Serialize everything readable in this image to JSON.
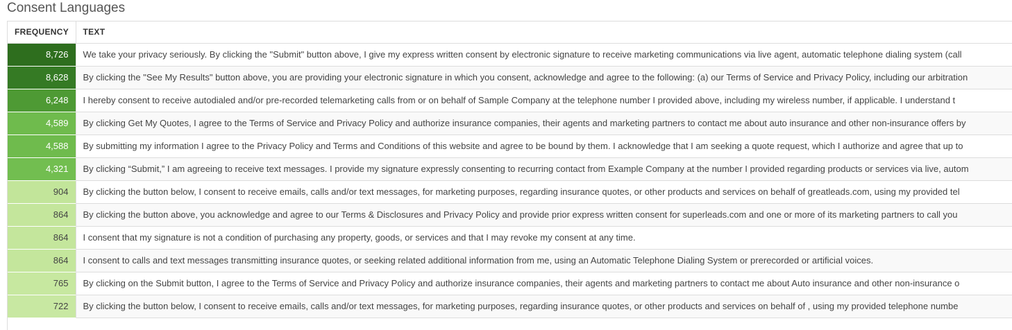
{
  "section": {
    "title": "Consent Languages"
  },
  "table": {
    "headers": {
      "frequency": "FREQUENCY",
      "text": "TEXT"
    },
    "rows": [
      {
        "frequency": "8,726",
        "text": "We take your privacy seriously. By clicking the \"Submit\" button above, I give my express written consent by electronic signature to receive marketing communications via live agent, automatic telephone dialing system (call",
        "bg": "#2e6e1e",
        "fg": "#ffffff"
      },
      {
        "frequency": "8,628",
        "text": "By clicking the \"See My Results\" button above, you are providing your electronic signature in which you consent, acknowledge and agree to the following: (a) our Terms of Service and Privacy Policy, including our arbitration",
        "bg": "#357a24",
        "fg": "#ffffff"
      },
      {
        "frequency": "6,248",
        "text": "I hereby consent to receive autodialed and/or pre-recorded telemarketing calls from or on behalf of Sample Company at the telephone number I provided above, including my wireless number, if applicable. I understand t",
        "bg": "#4e9a34",
        "fg": "#ffffff"
      },
      {
        "frequency": "4,589",
        "text": "By clicking Get My Quotes, I agree to the Terms of Service and Privacy Policy and authorize insurance companies, their agents and marketing partners to contact me about auto insurance and other non-insurance offers by",
        "bg": "#6fbb4d",
        "fg": "#ffffff"
      },
      {
        "frequency": "4,588",
        "text": "By submitting my information I agree to the Privacy Policy and Terms and Conditions of this website and agree to be bound by them. I acknowledge that I am seeking a quote request, which I authorize and agree that up to",
        "bg": "#6fbb4d",
        "fg": "#ffffff"
      },
      {
        "frequency": "4,321",
        "text": "By clicking “Submit,” I am agreeing to receive text messages. I provide my signature expressly consenting to recurring contact from Example Company at the number I provided regarding products or services via live, autom",
        "bg": "#72be50",
        "fg": "#ffffff"
      },
      {
        "frequency": "904",
        "text": "By clicking the button below, I consent to receive emails, calls and/or text messages, for marketing purposes, regarding insurance quotes, or other products and services on behalf of greatleads.com, using my provided tel",
        "bg": "#c2e59a",
        "fg": "#444444"
      },
      {
        "frequency": "864",
        "text": "By clicking the button above, you acknowledge and agree to our Terms & Disclosures and Privacy Policy and provide prior express written consent for superleads.com and one or more of its marketing partners to call you",
        "bg": "#c4e69c",
        "fg": "#444444"
      },
      {
        "frequency": "864",
        "text": "I consent that my signature is not a condition of purchasing any property, goods, or services and that I may revoke my consent at any time.",
        "bg": "#c4e69c",
        "fg": "#444444"
      },
      {
        "frequency": "864",
        "text": "I consent to calls and text messages transmitting insurance quotes, or seeking related additional information from me, using an Automatic Telephone Dialing System or prerecorded or artificial voices.",
        "bg": "#c4e69c",
        "fg": "#444444"
      },
      {
        "frequency": "765",
        "text": "By clicking on the Submit button, I agree to the Terms of Service and Privacy Policy and authorize insurance companies, their agents and marketing partners to contact me about Auto insurance and other non-insurance o",
        "bg": "#c7e8a0",
        "fg": "#444444"
      },
      {
        "frequency": "722",
        "text": "By clicking the button below, I consent to receive emails, calls and/or text messages, for marketing purposes, regarding insurance quotes, or other products and services on behalf of , using my provided telephone numbe",
        "bg": "#c8e8a2",
        "fg": "#444444"
      }
    ]
  }
}
